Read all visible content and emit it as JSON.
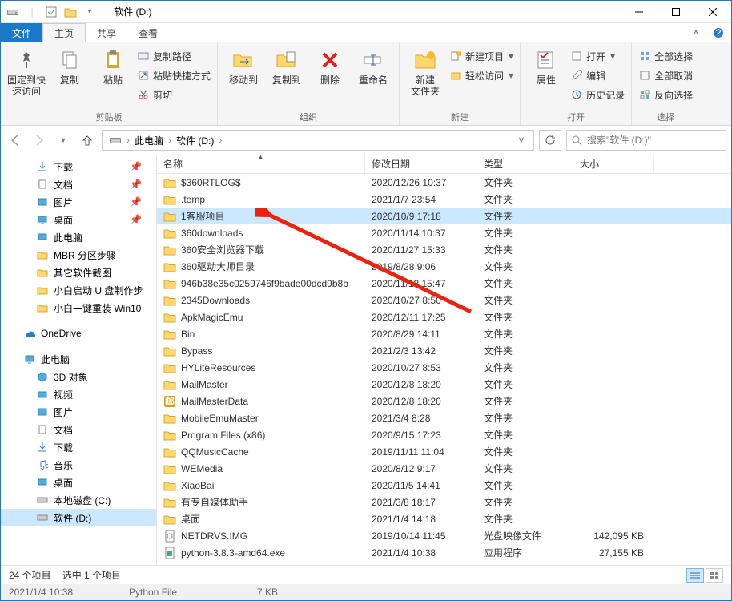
{
  "window": {
    "title": "软件 (D:)"
  },
  "tabs": {
    "file": "文件",
    "home": "主页",
    "share": "共享",
    "view": "查看"
  },
  "ribbon": {
    "group_clipboard": "剪贴板",
    "group_organize": "组织",
    "group_new": "新建",
    "group_open": "打开",
    "group_select": "选择",
    "pin": "固定到快\n速访问",
    "copy": "复制",
    "paste": "粘贴",
    "copy_path": "复制路径",
    "paste_shortcut": "粘贴快捷方式",
    "cut": "剪切",
    "move_to": "移动到",
    "copy_to": "复制到",
    "delete": "删除",
    "rename": "重命名",
    "new_folder": "新建\n文件夹",
    "new_item": "新建项目",
    "easy_access": "轻松访问",
    "properties": "属性",
    "open": "打开",
    "edit": "编辑",
    "history": "历史记录",
    "select_all": "全部选择",
    "select_none": "全部取消",
    "invert": "反向选择"
  },
  "breadcrumb": {
    "pc": "此电脑",
    "drive": "软件 (D:)"
  },
  "search": {
    "placeholder": "搜索\"软件 (D:)\""
  },
  "nav": {
    "downloads": "下载",
    "documents": "文档",
    "pictures": "图片",
    "desktop": "桌面",
    "this_pc": "此电脑",
    "mbr": "MBR 分区步骤",
    "other_sw": "其它软件截图",
    "xiaobai_u": "小白启动 U 盘制作步",
    "xiaobai_win10": "小白一键重装 Win10",
    "onedrive": "OneDrive",
    "this_pc2": "此电脑",
    "3d": "3D 对象",
    "video": "视频",
    "pictures2": "图片",
    "documents2": "文档",
    "downloads2": "下载",
    "music": "音乐",
    "desktop2": "桌面",
    "cdrive": "本地磁盘 (C:)",
    "ddrive": "软件 (D:)"
  },
  "columns": {
    "name": "名称",
    "date": "修改日期",
    "type": "类型",
    "size": "大小"
  },
  "files": [
    {
      "icon": "folder",
      "name": "$360RTLOG$",
      "date": "2020/12/26 10:37",
      "type": "文件夹",
      "size": ""
    },
    {
      "icon": "folder",
      "name": ".temp",
      "date": "2021/1/7 23:54",
      "type": "文件夹",
      "size": ""
    },
    {
      "icon": "folder",
      "name": "1客服项目",
      "date": "2020/10/9 17:18",
      "type": "文件夹",
      "size": "",
      "selected": true
    },
    {
      "icon": "folder",
      "name": "360downloads",
      "date": "2020/11/14 10:37",
      "type": "文件夹",
      "size": ""
    },
    {
      "icon": "folder",
      "name": "360安全浏览器下载",
      "date": "2020/11/27 15:33",
      "type": "文件夹",
      "size": ""
    },
    {
      "icon": "folder",
      "name": "360驱动大师目录",
      "date": "2019/8/28 9:06",
      "type": "文件夹",
      "size": ""
    },
    {
      "icon": "folder",
      "name": "946b38e35c0259746f9bade00dcd9b8b",
      "date": "2020/11/18 15:47",
      "type": "文件夹",
      "size": ""
    },
    {
      "icon": "folder",
      "name": "2345Downloads",
      "date": "2020/10/27 8:50",
      "type": "文件夹",
      "size": ""
    },
    {
      "icon": "folder",
      "name": "ApkMagicEmu",
      "date": "2020/12/11 17:25",
      "type": "文件夹",
      "size": ""
    },
    {
      "icon": "folder",
      "name": "Bin",
      "date": "2020/8/29 14:11",
      "type": "文件夹",
      "size": ""
    },
    {
      "icon": "folder",
      "name": "Bypass",
      "date": "2021/2/3 13:42",
      "type": "文件夹",
      "size": ""
    },
    {
      "icon": "folder",
      "name": "HYLiteResources",
      "date": "2020/10/27 8:53",
      "type": "文件夹",
      "size": ""
    },
    {
      "icon": "folder",
      "name": "MailMaster",
      "date": "2020/12/8 18:20",
      "type": "文件夹",
      "size": ""
    },
    {
      "icon": "mail",
      "name": "MailMasterData",
      "date": "2020/12/8 18:20",
      "type": "文件夹",
      "size": ""
    },
    {
      "icon": "folder",
      "name": "MobileEmuMaster",
      "date": "2021/3/4 8:28",
      "type": "文件夹",
      "size": ""
    },
    {
      "icon": "folder",
      "name": "Program Files (x86)",
      "date": "2020/9/15 17:23",
      "type": "文件夹",
      "size": ""
    },
    {
      "icon": "folder",
      "name": "QQMusicCache",
      "date": "2019/11/11 11:04",
      "type": "文件夹",
      "size": ""
    },
    {
      "icon": "folder",
      "name": "WEMedia",
      "date": "2020/8/12 9:17",
      "type": "文件夹",
      "size": ""
    },
    {
      "icon": "folder",
      "name": "XiaoBai",
      "date": "2020/11/5 14:41",
      "type": "文件夹",
      "size": ""
    },
    {
      "icon": "folder",
      "name": "有专自媒体助手",
      "date": "2021/3/8 18:17",
      "type": "文件夹",
      "size": ""
    },
    {
      "icon": "folder",
      "name": "桌面",
      "date": "2021/1/4 14:18",
      "type": "文件夹",
      "size": ""
    },
    {
      "icon": "file",
      "name": "NETDRVS.IMG",
      "date": "2019/10/14 11:45",
      "type": "光盘映像文件",
      "size": "142,095 KB"
    },
    {
      "icon": "exe",
      "name": "python-3.8.3-amd64.exe",
      "date": "2021/1/4 10:38",
      "type": "应用程序",
      "size": "27,155 KB"
    }
  ],
  "status": {
    "count": "24 个项目",
    "selected": "选中 1 个项目"
  },
  "bottom": {
    "time": "2021/1/4 10:38",
    "filetype": "Python File",
    "filesize": "7 KB"
  }
}
